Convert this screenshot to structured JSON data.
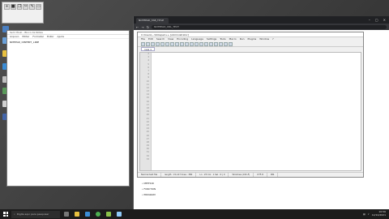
{
  "desktop": {
    "icons": [
      {
        "label": "",
        "color": "#4a7fc1"
      },
      {
        "label": "",
        "color": "#6aa0d8"
      },
      {
        "label": "",
        "color": "#e8c040"
      },
      {
        "label": "",
        "color": "#3b8dd6"
      },
      {
        "label": "",
        "color": "#c0c0c0"
      },
      {
        "label": "",
        "color": "#5a9a5a"
      },
      {
        "label": "",
        "color": "#d0d0d0"
      },
      {
        "label": "",
        "color": "#4466aa"
      }
    ]
  },
  "notepad": {
    "title": "Sem título - Bloco de Notas",
    "menu": [
      "Arquivo",
      "Editar",
      "Formatar",
      "Exibir",
      "Ajuda"
    ],
    "text": "NOTEPAD_CONTENT_LINE"
  },
  "browser": {
    "tab": "NOTEPAD_TAB_TITLE",
    "url": "NOTEPAD_URL_TEXT"
  },
  "notepadpp": {
    "title": "C:\\Users\\...\\Notepad++ [Administrator]",
    "menu": [
      "File",
      "Edit",
      "Search",
      "View",
      "Encoding",
      "Language",
      "Settings",
      "Tools",
      "Macro",
      "Run",
      "Plugins",
      "Window",
      "?"
    ],
    "file_tab": "new 1",
    "line_numbers": [
      "2",
      "3",
      "4",
      "5",
      "6",
      "7",
      "8",
      "9",
      "10",
      "11",
      "12",
      "13",
      "14",
      "15",
      "16",
      "17",
      "18",
      "19",
      "20",
      "21",
      "22",
      "23",
      "24",
      "25",
      "26",
      "27",
      "28",
      "29",
      "30",
      "31",
      "32",
      "33"
    ],
    "status": [
      "Normal text file",
      "length : 15,147   lines : 380",
      "Ln : 25   Col : 1   Sel : 0 | 0",
      "Windows (CR LF)",
      "UTF-8",
      "INS"
    ]
  },
  "page": {
    "bullets": [
      "METHOD",
      "FUNCTION",
      "PROGRAM"
    ]
  },
  "taskbar": {
    "search_placeholder": "Digite aqui para pesquisar",
    "time": "10:56",
    "date": "12/10/2021"
  }
}
